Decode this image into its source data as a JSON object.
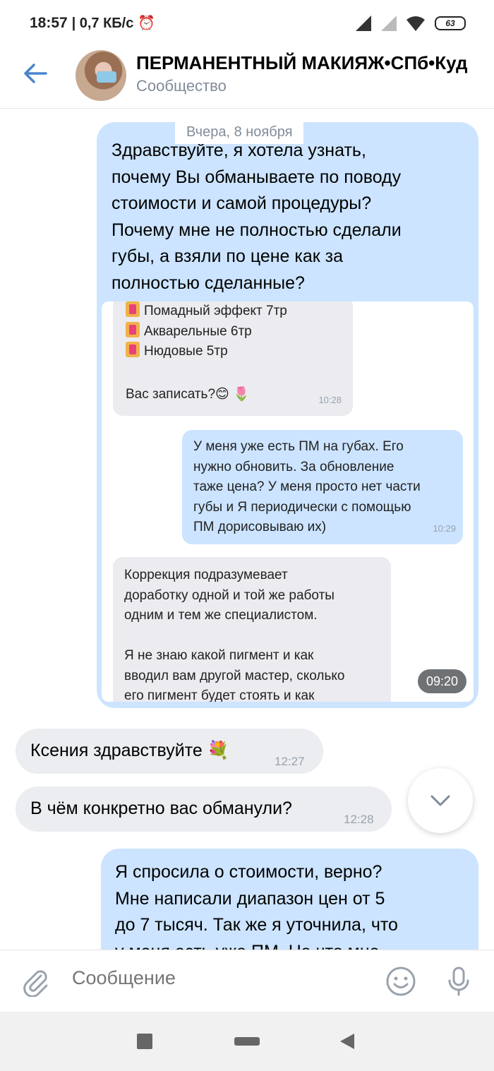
{
  "status_bar": {
    "time": "18:57",
    "speed": "| 0,7 КБ/с",
    "battery": "63"
  },
  "header": {
    "title": "ПЕРМАНЕНТНЫЙ МАКИЯЖ•СПб•Куд",
    "subtitle": "Сообщество"
  },
  "messages": {
    "own_1": {
      "date": "Вчера, 8 ноября",
      "lines": [
        "Здравствуйте, я хотела узнать,",
        "почему Вы обманываете по поводу",
        "стоимости и самой процедуры?",
        "Почему мне не полностью сделали",
        "губы, а взяли по цене как за",
        "полностью сделанные?"
      ],
      "time": "09:20",
      "screenshot": {
        "in1_lines": [
          "Помадный эффект 7тр",
          "Акварельные 6тр",
          "Нюдовые 5тр",
          "",
          "Вас записать?😊 🌷"
        ],
        "in1_time": "10:28",
        "out_lines": [
          "У меня уже есть ПМ на губах. Его",
          "нужно обновить. За обновление",
          "таже цена? У меня просто нет части",
          "губы и Я периодически с помощью",
          "ПМ дорисовываю их)"
        ],
        "out_time": "10:29",
        "in2_lines": [
          "Коррекция подразумевает",
          "доработку одной и той же работы",
          "одним и тем же специалистом.",
          "",
          "Я не знаю какой пигмент и как",
          "вводил вам другой мастер, сколько",
          "его пигмент будет стоять и как"
        ]
      }
    },
    "in_1": {
      "text": "Ксения здравствуйте 💐",
      "time": "12:27"
    },
    "in_2": {
      "text": "В чём конкретно вас обманули?",
      "time": "12:28"
    },
    "own_2": {
      "lines": [
        "Я спросила о стоимости, верно?",
        "Мне написали диапазон цен от 5",
        "до 7 тысяч. Так же я уточнила, что",
        "у меня есть уже ПМ. На что мне"
      ]
    }
  },
  "composer": {
    "placeholder": "Сообщение"
  },
  "icons": {
    "back": "back-arrow-icon",
    "attach": "paperclip-icon",
    "emoji": "smile-icon",
    "mic": "microphone-icon",
    "scroll": "chevron-down-icon"
  },
  "colors": {
    "accent": "#4986cc",
    "own_bubble": "#cce4ff",
    "incoming_bubble": "#ebedf0"
  }
}
